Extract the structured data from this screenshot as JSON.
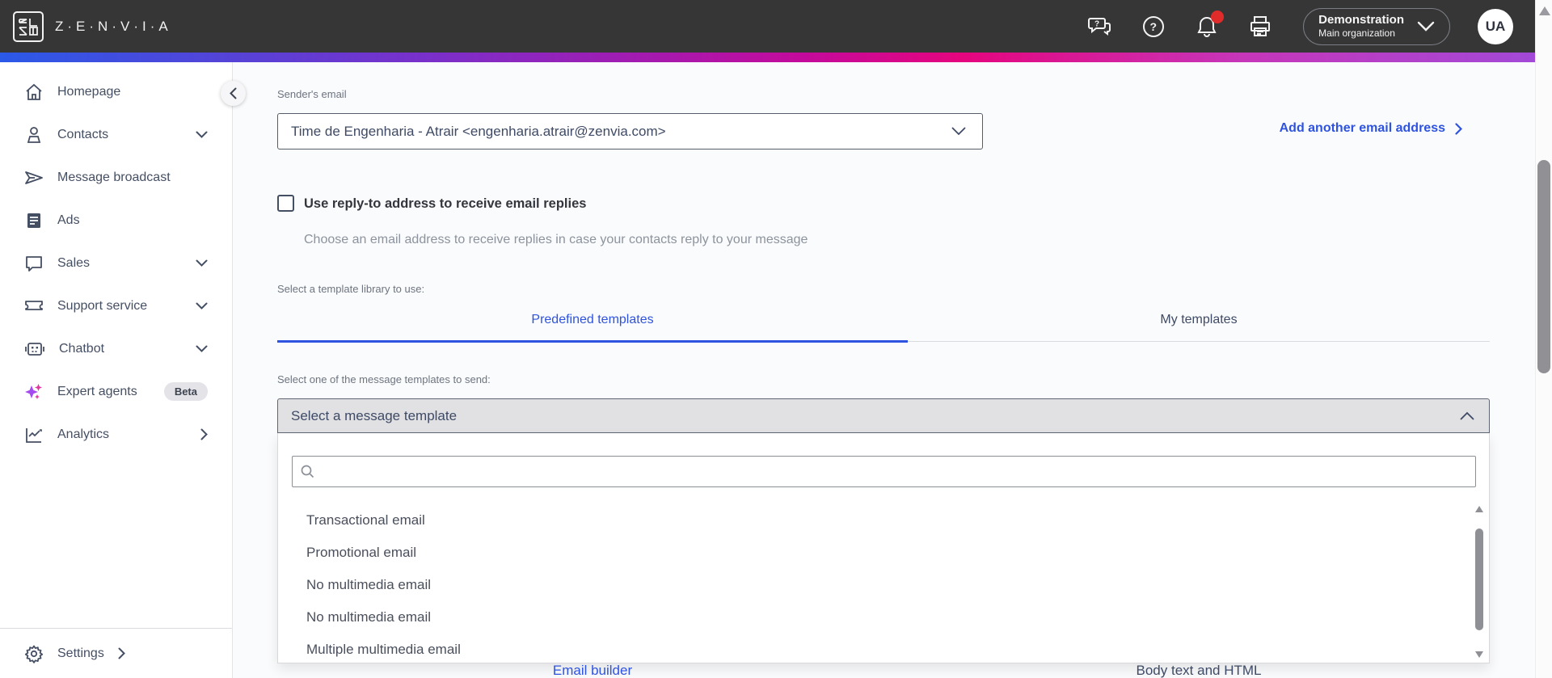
{
  "topbar": {
    "brand": "Z·E·N·V·I·A",
    "icons": {
      "support_chat": "chat-question-icon",
      "help": "help-circle-icon",
      "notifications": "bell-icon",
      "print": "printer-icon"
    },
    "notification_badge_color": "#e02b2b",
    "org": {
      "name": "Demonstration",
      "sub": "Main organization"
    },
    "avatar_initials": "UA"
  },
  "colors": {
    "topbar_bg": "#363636",
    "accent_blue": "#2e53e0",
    "gradient": [
      "#2b59e8",
      "#7b2fc9",
      "#e5057e",
      "#a04ad9"
    ],
    "sidebar_text": "#454f63",
    "value_text": "#3e4a66"
  },
  "sidebar": {
    "items": [
      {
        "label": "Homepage",
        "icon": "home-icon",
        "chevron": ""
      },
      {
        "label": "Contacts",
        "icon": "person-icon",
        "chevron": "down"
      },
      {
        "label": "Message broadcast",
        "icon": "send-icon",
        "chevron": ""
      },
      {
        "label": "Ads",
        "icon": "ads-icon",
        "chevron": ""
      },
      {
        "label": "Sales",
        "icon": "chat-bubble-icon",
        "chevron": "down"
      },
      {
        "label": "Support service",
        "icon": "ticket-icon",
        "chevron": "down"
      },
      {
        "label": "Chatbot",
        "icon": "robot-icon",
        "chevron": "down"
      },
      {
        "label": "Expert agents",
        "icon": "sparkles-icon",
        "badge": "Beta"
      },
      {
        "label": "Analytics",
        "icon": "analytics-icon",
        "chevron": "right"
      }
    ],
    "settings": {
      "label": "Settings",
      "icon": "gear-icon",
      "chevron": "right"
    }
  },
  "main": {
    "sender": {
      "label": "Sender's email",
      "value": "Time de Engenharia - Atrair <engenharia.atrair@zenvia.com>"
    },
    "add_email_link": "Add another email address",
    "reply_to": {
      "checkbox_label": "Use reply-to address to receive email replies",
      "helper": "Choose an email address to receive replies in case your contacts reply to your message",
      "checked": false
    },
    "library_label": "Select a template library to use:",
    "tabs": [
      {
        "label": "Predefined templates",
        "active": true
      },
      {
        "label": "My templates",
        "active": false
      }
    ],
    "template_label": "Select one of the message templates to send:",
    "template_dropdown": {
      "value": "Select a message template",
      "search_value": "",
      "options": [
        "Transactional email",
        "Promotional email",
        "No multimedia email",
        "No multimedia email",
        "Multiple multimedia email"
      ]
    },
    "bottom_tabs": [
      {
        "label": "Email builder"
      },
      {
        "label": "Body text and HTML"
      }
    ]
  }
}
